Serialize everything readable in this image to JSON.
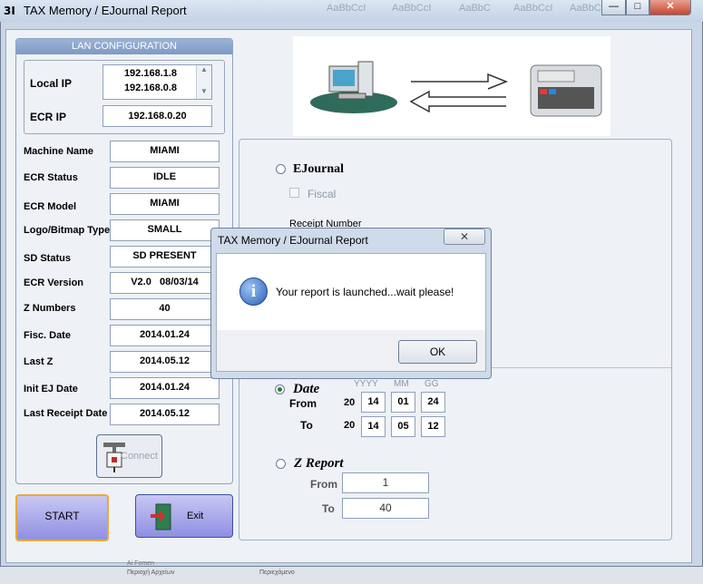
{
  "window": {
    "title": "TAX Memory / EJournal Report",
    "logo": "3I",
    "controls": [
      "minimize",
      "maximize",
      "close"
    ],
    "background_tabs": [
      "AaBbCcI",
      "AaBbCcI",
      "AaBbC",
      "AaBbCcI",
      "AaBbCcI"
    ]
  },
  "lan": {
    "header": "LAN CONFIGURATION",
    "local_ip_label": "Local IP",
    "local_ips": [
      "192.168.1.8",
      "192.168.0.8"
    ],
    "ecr_ip_label": "ECR IP",
    "ecr_ip": "192.168.0.20"
  },
  "info": [
    {
      "label": "Machine Name",
      "value": "MIAMI"
    },
    {
      "label": "ECR Status",
      "value": "IDLE"
    },
    {
      "label": "ECR Model",
      "value": "MIAMI"
    },
    {
      "label": "Logo/Bitmap Type",
      "value": "SMALL"
    },
    {
      "label": "SD Status",
      "value": "SD PRESENT"
    },
    {
      "label": "ECR Version",
      "value": "V2.0   08/03/14"
    },
    {
      "label": "Z Numbers",
      "value": "40"
    },
    {
      "label": "Fisc. Date",
      "value": "2014.01.24"
    },
    {
      "label": "Last Z",
      "value": "2014.05.12"
    },
    {
      "label": "Init EJ Date",
      "value": "2014.01.24"
    },
    {
      "label": "Last Receipt Date",
      "value": "2014.05.12"
    }
  ],
  "buttons": {
    "connect": "Connect",
    "start": "START",
    "exit": "Exit"
  },
  "report": {
    "ejournal_label": "EJournal",
    "fiscal_label": "Fiscal",
    "receipt_number_label": "Receipt Number",
    "date_label": "Date",
    "date_headers": [
      "YYYY",
      "MM",
      "GG"
    ],
    "from_label": "From",
    "to_label": "To",
    "century": "20",
    "from_date": [
      "14",
      "01",
      "24"
    ],
    "to_date": [
      "14",
      "05",
      "12"
    ],
    "zreport_label": "Z Report",
    "z_from": "1",
    "z_to": "40"
  },
  "dialog": {
    "title": "TAX Memory / EJournal Report",
    "close": "✕",
    "message": "Your report is launched...wait please!",
    "ok": "OK",
    "icon": "info-icon"
  },
  "taskbar": {
    "item1": "Περιοχή Αρχείων",
    "item2": "Περιεχόμενο",
    "item0": "Ai Fomen"
  }
}
